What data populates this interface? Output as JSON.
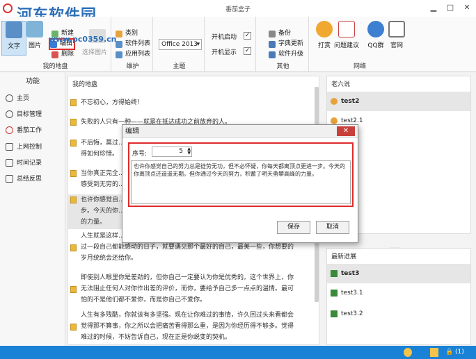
{
  "window": {
    "title": "番茄盒子",
    "watermark": "河东软件园",
    "watermark_url": "www.pc0359.cn"
  },
  "ribbon": {
    "my_notes": {
      "label": "我的地盘",
      "text_btn": "文字",
      "image_btn": "图片",
      "new": "新建",
      "edit": "编辑",
      "delete": "删除",
      "select_image": "选择图片"
    },
    "maintain": {
      "label": "维护",
      "category": "类别",
      "software_list": "软件列表",
      "app_list": "应用列表"
    },
    "theme": {
      "label": "主题",
      "value": "Office 2013"
    },
    "settings": {
      "autostart": "开机启动",
      "autoshow": "开机显示"
    },
    "other": {
      "label": "其他",
      "backup": "备份",
      "dict_update": "字典更新",
      "upgrade": "软件升级"
    },
    "network": {
      "label": "网络",
      "tip": "打赏",
      "feedback": "问题建议",
      "qq": "QQ群",
      "site": "官网"
    }
  },
  "nav": {
    "heading": "功能",
    "items": [
      "主页",
      "目标管理",
      "番茄工作",
      "上网控制",
      "时间记录",
      "总结反思"
    ]
  },
  "notes": {
    "heading": "我的地盘",
    "items": [
      "不忘初心，方得始终！",
      "失败的人只有一种——就是在抵达成功之前放弃的人。",
      "不后悔，莫过…",
      "得如何珍惜。",
      "当你真正完全…",
      "感受到无穷的…",
      "也许你感觉自…",
      "步。今天的你…",
      "的力量。",
      "人生就是这样…",
      "过一段自己都能感动的日子，就要遇见那个最好的自己，最美一些，你想要的",
      "岁月统统会还给你。",
      "即使别人眼里你是差劲的，但你自己一定要认为你是优秀的。这个世界上，你",
      "无法阻止任何人对你作出差的评价，而你，要给予自己多一点点的温情。最可",
      "怕的不是他们都不爱你，而是你自己不爱你。",
      "人生有多残酷，你就该有多坚强。现在让你难过的事情，许久回过头来看都会",
      "觉得那不算事，你之所以会把痛苦看得那么重，是因为你经历得不够多。觉得",
      "难过的时候，不妨告诉自己，现在正是你蜕变的契机。"
    ]
  },
  "old_sayings": {
    "heading": "老六说",
    "items": [
      "test2",
      "test2.1"
    ]
  },
  "progress": {
    "heading": "最新进展",
    "items": [
      "test3",
      "test3.1",
      "test3.2"
    ]
  },
  "dialog": {
    "title": "编辑",
    "seq_label": "序号:",
    "seq_value": "5",
    "content": "也许你感觉自己的努力总是徒劳无功，但不必怀疑，你每天都离顶点更进一步。今天的你离顶点还遥遥无期。但你通过今天的努力，积蓄了明天勇攀高峰的力量。",
    "save": "保存",
    "cancel": "取消"
  },
  "status": {
    "count": "(1)"
  }
}
